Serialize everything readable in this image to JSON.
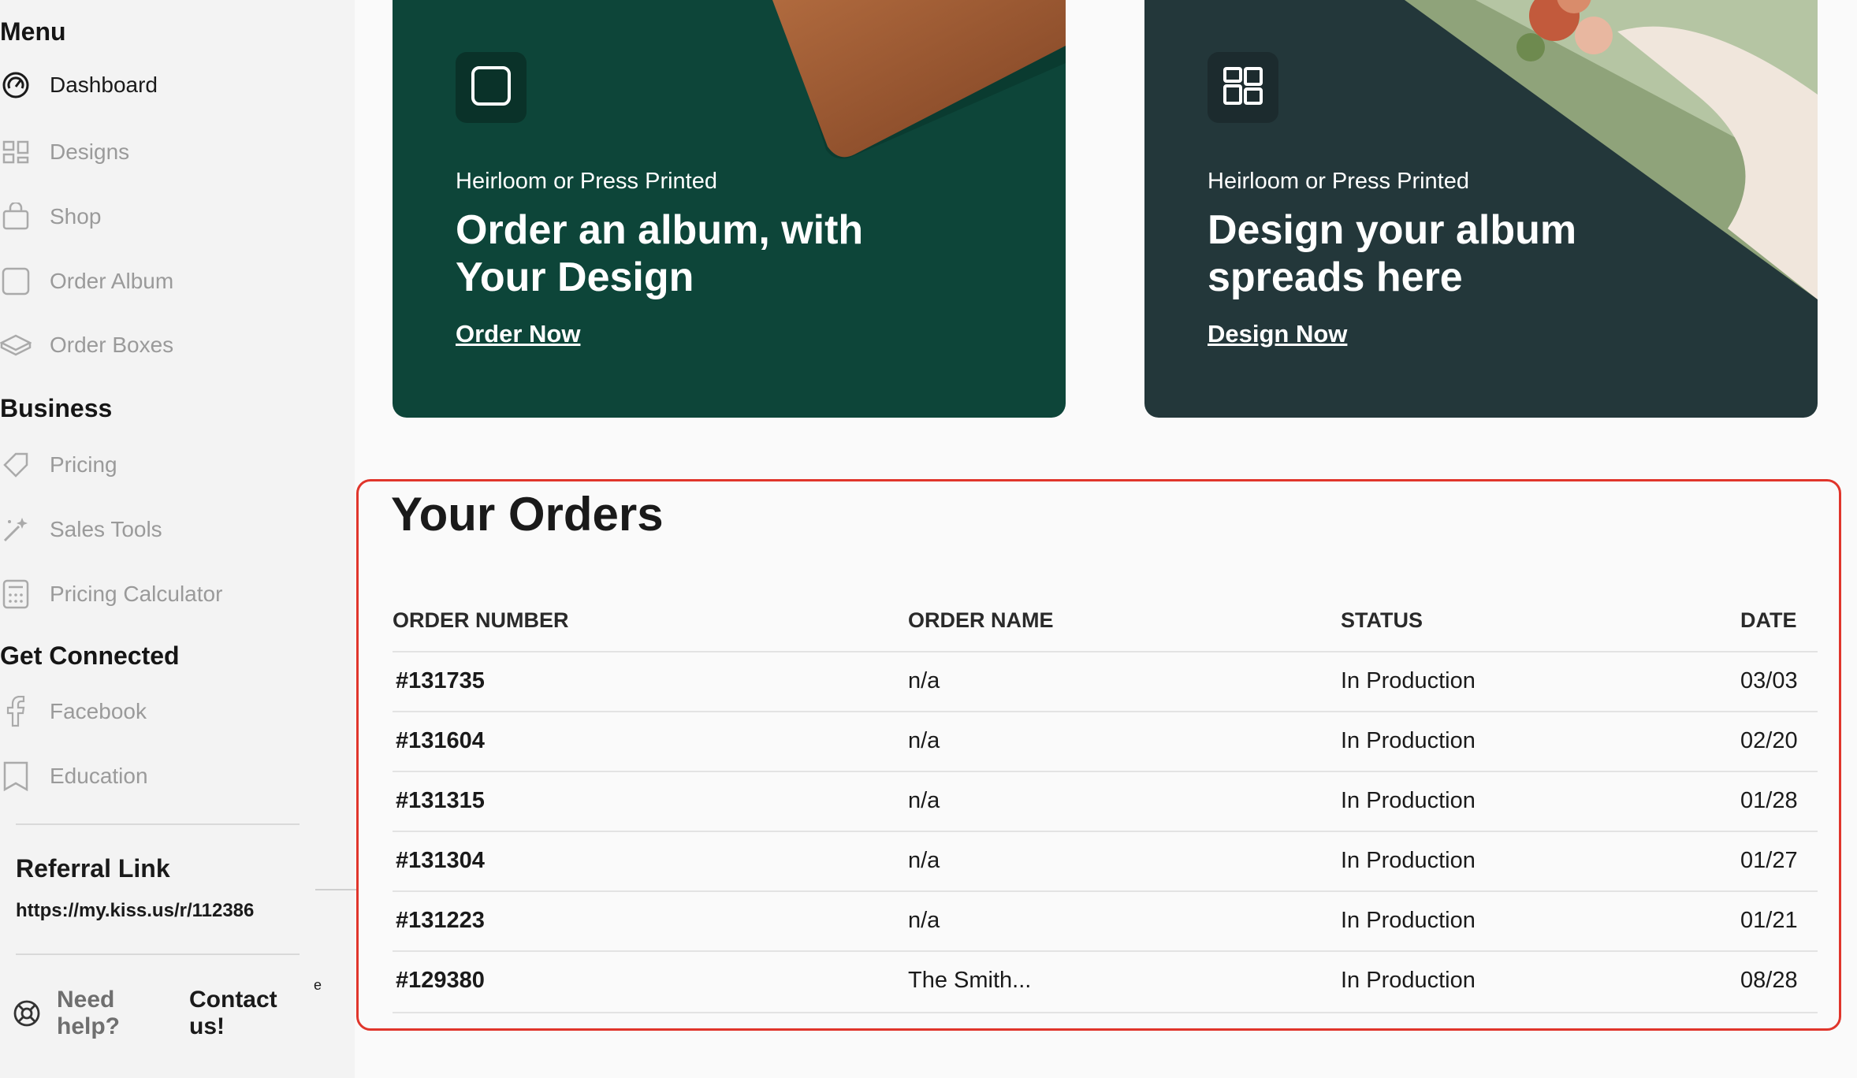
{
  "sidebar": {
    "menu_title": "Menu",
    "menu_items": [
      {
        "label": "Dashboard",
        "icon": "gauge-icon",
        "active": true
      },
      {
        "label": "Designs",
        "icon": "layout-icon"
      },
      {
        "label": "Shop",
        "icon": "shopping-bag-icon"
      },
      {
        "label": "Order Album",
        "icon": "square-icon"
      },
      {
        "label": "Order Boxes",
        "icon": "box-icon"
      }
    ],
    "business_title": "Business",
    "business_items": [
      {
        "label": "Pricing",
        "icon": "tag-icon"
      },
      {
        "label": "Sales Tools",
        "icon": "magic-wand-icon"
      },
      {
        "label": "Pricing Calculator",
        "icon": "calculator-icon"
      }
    ],
    "connected_title": "Get Connected",
    "connected_items": [
      {
        "label": "Facebook",
        "icon": "facebook-icon"
      },
      {
        "label": "Education",
        "icon": "book-icon"
      }
    ],
    "referral_title": "Referral Link",
    "referral_url": "https://my.kiss.us/r/112386",
    "need_help": "Need help?",
    "contact": "Contact us!",
    "stray": "e"
  },
  "cards": [
    {
      "subtitle": "Heirloom or Press Printed",
      "title": "Order an album, with Your Design",
      "link": "Order Now",
      "icon": "square-icon"
    },
    {
      "subtitle": "Heirloom or Press Printed",
      "title": "Design your album spreads here",
      "link": "Design Now",
      "icon": "layout-icon"
    }
  ],
  "orders": {
    "title": "Your Orders",
    "columns": [
      "ORDER NUMBER",
      "ORDER NAME",
      "STATUS",
      "DATE"
    ],
    "rows": [
      {
        "number": "#131735",
        "name": "n/a",
        "status": "In Production",
        "date": "03/03"
      },
      {
        "number": "#131604",
        "name": "n/a",
        "status": "In Production",
        "date": "02/20"
      },
      {
        "number": "#131315",
        "name": "n/a",
        "status": "In Production",
        "date": "01/28"
      },
      {
        "number": "#131304",
        "name": "n/a",
        "status": "In Production",
        "date": "01/27"
      },
      {
        "number": "#131223",
        "name": "n/a",
        "status": "In Production",
        "date": "01/21"
      },
      {
        "number": "#129380",
        "name": "The Smith...",
        "status": "In Production",
        "date": "08/28"
      }
    ]
  },
  "colors": {
    "card1": "#0d4539",
    "card2": "#23373a",
    "highlight": "#e0352b"
  }
}
